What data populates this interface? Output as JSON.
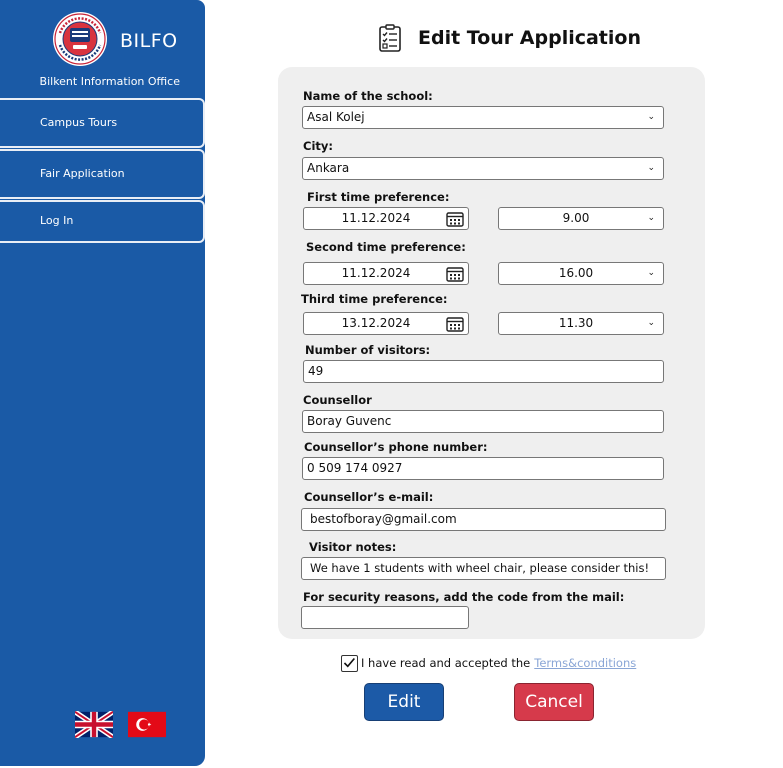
{
  "sidebar": {
    "brand": {
      "name": "BILFO",
      "subtitle": "Bilkent Information Office",
      "logo_text": "İhsan Doğramacı Bilkent Üniversitesi"
    },
    "nav": [
      {
        "label": "Campus Tours"
      },
      {
        "label": "Fair Application"
      },
      {
        "label": "Log In"
      }
    ],
    "languages": [
      {
        "name": "uk-flag-icon"
      },
      {
        "name": "turkey-flag-icon"
      }
    ]
  },
  "header": {
    "title": "Edit Tour Application",
    "icon": "clipboard-checklist-icon"
  },
  "form": {
    "school_label": "Name of the school:",
    "school_value": "Asal Kolej",
    "city_label": "City:",
    "city_value": "Ankara",
    "pref1_label": "First time preference:",
    "pref1_date": "11.12.2024",
    "pref1_time": "9.00",
    "pref2_label": "Second time preference:",
    "pref2_date": "11.12.2024",
    "pref2_time": "16.00",
    "pref3_label": "Third time preference:",
    "pref3_date": "13.12.2024",
    "pref3_time": "11.30",
    "visitors_label": "Number of visitors:",
    "visitors_value": "49",
    "counsellor_label": "Counsellor",
    "counsellor_value": "Boray Guvenc",
    "phone_label": "Counsellor’s phone number:",
    "phone_value": "0 509 174 0927",
    "email_label": "Counsellor’s e-mail:",
    "email_value": "bestofboray@gmail.com",
    "notes_label": "Visitor notes:",
    "notes_value": "We have 1 students with wheel chair, please consider this!",
    "code_label": "For security reasons, add the code from the mail:",
    "code_value": ""
  },
  "terms": {
    "checked": true,
    "text": "I have read and accepted the",
    "link": "Terms&conditions"
  },
  "actions": {
    "edit": "Edit",
    "cancel": "Cancel"
  },
  "colors": {
    "sidebar": "#1a5aa6",
    "panel": "#efefef",
    "edit_button": "#1c5aa7",
    "cancel_button": "#d63a4b",
    "link": "#8aa6d6"
  }
}
